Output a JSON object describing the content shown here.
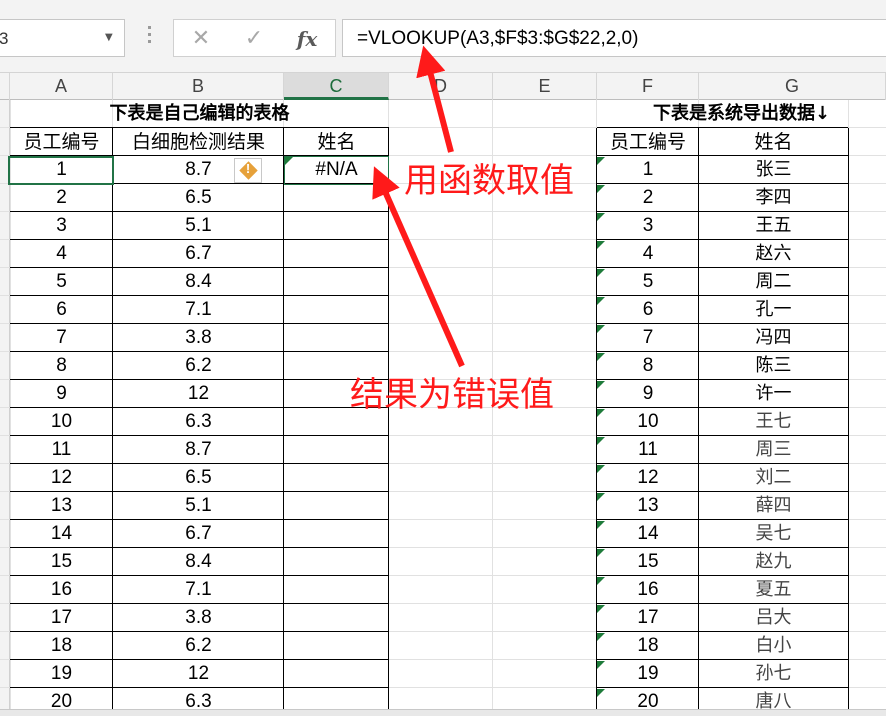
{
  "name_box": {
    "value": "3"
  },
  "formula_bar": {
    "cancel_icon": "close-icon",
    "enter_icon": "check-icon",
    "fx_label": "fx",
    "formula": "=VLOOKUP(A3,$F$3:$G$22,2,0)"
  },
  "columns": [
    "A",
    "B",
    "C",
    "D",
    "E",
    "F",
    "G"
  ],
  "active_column": "C",
  "left_table": {
    "title": "下表是自己编辑的表格",
    "headers": [
      "员工编号",
      "白细胞检测结果",
      "姓名"
    ],
    "rows": [
      {
        "id": "1",
        "result": "8.7",
        "name": "#N/A"
      },
      {
        "id": "2",
        "result": "6.5",
        "name": ""
      },
      {
        "id": "3",
        "result": "5.1",
        "name": ""
      },
      {
        "id": "4",
        "result": "6.7",
        "name": ""
      },
      {
        "id": "5",
        "result": "8.4",
        "name": ""
      },
      {
        "id": "6",
        "result": "7.1",
        "name": ""
      },
      {
        "id": "7",
        "result": "3.8",
        "name": ""
      },
      {
        "id": "8",
        "result": "6.2",
        "name": ""
      },
      {
        "id": "9",
        "result": "12",
        "name": ""
      },
      {
        "id": "10",
        "result": "6.3",
        "name": ""
      },
      {
        "id": "11",
        "result": "8.7",
        "name": ""
      },
      {
        "id": "12",
        "result": "6.5",
        "name": ""
      },
      {
        "id": "13",
        "result": "5.1",
        "name": ""
      },
      {
        "id": "14",
        "result": "6.7",
        "name": ""
      },
      {
        "id": "15",
        "result": "8.4",
        "name": ""
      },
      {
        "id": "16",
        "result": "7.1",
        "name": ""
      },
      {
        "id": "17",
        "result": "3.8",
        "name": ""
      },
      {
        "id": "18",
        "result": "6.2",
        "name": ""
      },
      {
        "id": "19",
        "result": "12",
        "name": ""
      },
      {
        "id": "20",
        "result": "6.3",
        "name": ""
      }
    ]
  },
  "right_table": {
    "title": "下表是系统导出数据↓",
    "headers": [
      "员工编号",
      "姓名"
    ],
    "rows": [
      {
        "id": "1",
        "name": "张三"
      },
      {
        "id": "2",
        "name": "李四"
      },
      {
        "id": "3",
        "name": "王五"
      },
      {
        "id": "4",
        "name": "赵六"
      },
      {
        "id": "5",
        "name": "周二"
      },
      {
        "id": "6",
        "name": "孔一"
      },
      {
        "id": "7",
        "name": "冯四"
      },
      {
        "id": "8",
        "name": "陈三"
      },
      {
        "id": "9",
        "name": "许一"
      },
      {
        "id": "10",
        "name": "王七"
      },
      {
        "id": "11",
        "name": "周三"
      },
      {
        "id": "12",
        "name": "刘二"
      },
      {
        "id": "13",
        "name": "薛四"
      },
      {
        "id": "14",
        "name": "吴七"
      },
      {
        "id": "15",
        "name": "赵九"
      },
      {
        "id": "16",
        "name": "夏五"
      },
      {
        "id": "17",
        "name": "吕大"
      },
      {
        "id": "18",
        "name": "白小"
      },
      {
        "id": "19",
        "name": "孙七"
      },
      {
        "id": "20",
        "name": "唐八"
      }
    ]
  },
  "annotations": {
    "formula_note": "用函数取值",
    "error_note": "结果为错误值",
    "color": "#ff1a1a"
  },
  "colors": {
    "excel_green": "#217346",
    "error_triangle": "#1e7b3a",
    "warning": "#e6a13a"
  },
  "warning_icon": "warning-icon"
}
